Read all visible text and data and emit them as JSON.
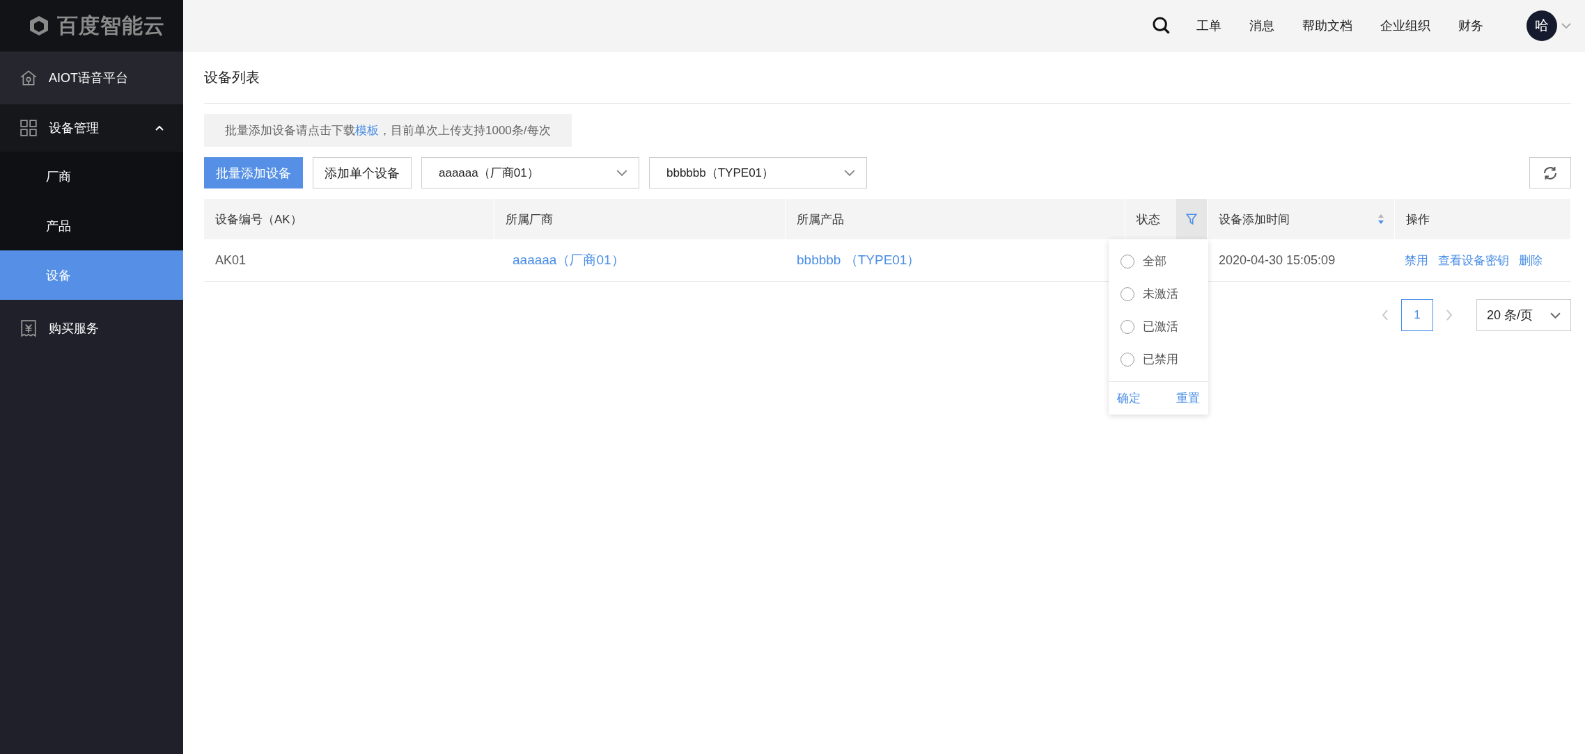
{
  "brand": {
    "name": "百度智能云"
  },
  "sidebar": {
    "items": [
      {
        "label": "AIOT语音平台",
        "selected": false
      },
      {
        "label": "设备管理",
        "selected": false,
        "expanded": true,
        "children": [
          {
            "label": "厂商",
            "selected": false
          },
          {
            "label": "产品",
            "selected": false
          },
          {
            "label": "设备",
            "selected": true
          }
        ]
      },
      {
        "label": "购买服务",
        "selected": false
      }
    ]
  },
  "header": {
    "nav": [
      "工单",
      "消息",
      "帮助文档",
      "企业组织",
      "财务"
    ],
    "avatar": "哈"
  },
  "page": {
    "title": "设备列表",
    "notice": {
      "before": "批量添加设备请点击下载",
      "link": "模板",
      "after": "，目前单次上传支持1000条/每次"
    },
    "buttons": [
      {
        "label": "批量添加设备",
        "primary": true
      },
      {
        "label": "添加单个设备",
        "primary": false
      }
    ],
    "selects": [
      {
        "value": "aaaaaa（厂商01）"
      },
      {
        "value": "bbbbbb（TYPE01）"
      }
    ]
  },
  "table": {
    "columns": [
      {
        "label": "设备编号（AK）"
      },
      {
        "label": "所属厂商"
      },
      {
        "label": "所属产品"
      },
      {
        "label": "状态",
        "filter": true
      },
      {
        "label": "设备添加时间",
        "sortable": true,
        "sorted_descending": true
      },
      {
        "label": "操作"
      }
    ],
    "rows": [
      {
        "ak": "AK01",
        "vendor": "aaaaaa（厂商01）",
        "product": "bbbbbb （TYPE01）",
        "added": "2020-04-30 15:05:09",
        "actions": [
          "禁用",
          "查看设备密钥",
          "删除"
        ]
      }
    ]
  },
  "status_filter": {
    "options": [
      {
        "label": "全部",
        "selected": false
      },
      {
        "label": "未激活",
        "selected": false
      },
      {
        "label": "已激活",
        "selected": false
      },
      {
        "label": "已禁用",
        "selected": false
      }
    ],
    "confirm": "确定",
    "reset": "重置"
  },
  "pagination": {
    "pages": [
      {
        "label": "1",
        "selected": true
      }
    ],
    "page_size": "20 条/页"
  }
}
